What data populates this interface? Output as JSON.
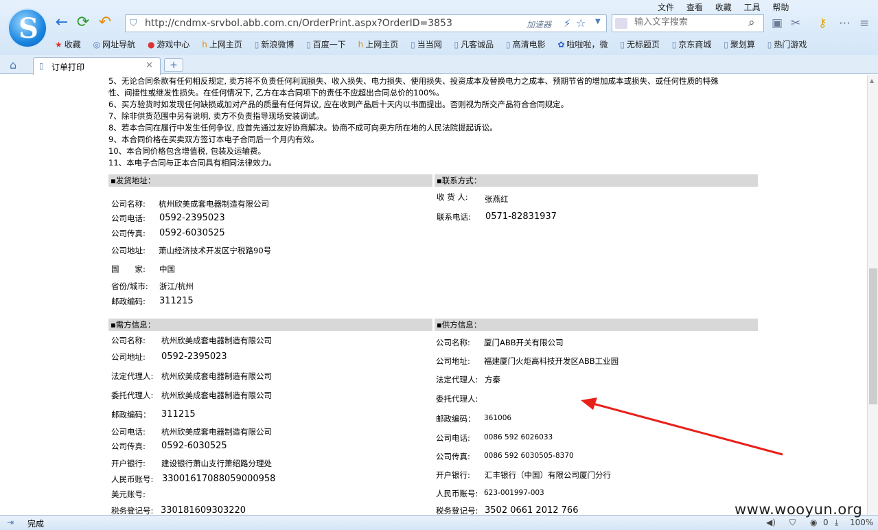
{
  "menu": [
    "文件",
    "查看",
    "收藏",
    "工具",
    "帮助"
  ],
  "address": {
    "url": "http://cndmx-srvbol.abb.com.cn/OrderPrint.aspx?OrderID=3853",
    "accelerator": "加速器"
  },
  "search": {
    "placeholder": "输入文字搜索"
  },
  "bookmarks": [
    "收藏",
    "网址导航",
    "游戏中心",
    "上网主页",
    "新浪微博",
    "百度一下",
    "上网主页",
    "当当网",
    "凡客诚品",
    "高清电影",
    "啦啦啦，微",
    "无标题页",
    "京东商城",
    "聚划算",
    "热门游戏"
  ],
  "tab": {
    "title": "订单打印"
  },
  "terms": [
    "5、无论合同条款有任何相反规定, 卖方将不负责任何利润损失、收入损失、电力损失、使用损失、投资成本及替换电力之成本、预期节省的增加成本或损失、或任何性质的特殊",
    "性、间接性或继发性损失。在任何情况下, 乙方在本合同项下的责任不应超出合同总价的100%。",
    "6、买方验货时如发现任何缺损或加对产品的质量有任何异议, 应在收到产品后十天内以书面提出。否则视为所交产品符合合同规定。",
    "7、除非供货范围中另有说明, 卖方不负责指导现场安装调试。",
    "8、若本合同在履行中发生任何争议, 应首先通过友好协商解决。协商不成可向卖方所在地的人民法院提起诉讼。",
    "9、本合同价格在买卖双方签订本电子合同后一个月内有效。",
    "10、本合同价格包含增值税, 包装及运输费。",
    "11、本电子合同与正本合同具有相同法律效力。"
  ],
  "shipping": {
    "header": "▪发货地址：",
    "company_k": "公司名称:",
    "company_v": "杭州欣美成套电器制造有限公司",
    "phone_k": "公司电话:",
    "phone_v": "0592-2395023",
    "fax_k": "公司传真:",
    "fax_v": "0592-6030525",
    "address_k": "公司地址:",
    "address_v": "萧山经济技术开发区宁税路90号",
    "country_k": "国　　家:",
    "country_v": "中国",
    "city_k": "省份/城市:",
    "city_v": "浙江/杭州",
    "zip_k": "邮政编码:",
    "zip_v": "311215"
  },
  "contact": {
    "header": "▪联系方式：",
    "recipient_k": "收 货 人:",
    "recipient_v": "张燕红",
    "phone_k": "联系电话:",
    "phone_v": "0571-82831937"
  },
  "buyer": {
    "header": "▪需方信息：",
    "company_k": "公司名称:",
    "company_v": "杭州欣美成套电器制造有限公司",
    "address_k": "公司地址:",
    "address_v": "0592-2395023",
    "legal_k": "法定代理人:",
    "legal_v": "杭州欣美成套电器制造有限公司",
    "agent_k": "委托代理人:",
    "agent_v": "杭州欣美成套电器制造有限公司",
    "zip_k": "邮政编码：",
    "zip_v": "311215",
    "phone_k": "公司电话:",
    "phone_v": "杭州欣美成套电器制造有限公司",
    "fax_k": "公司传真:",
    "fax_v": "0592-6030525",
    "bank_k": "开户银行:",
    "bank_v": "建设银行萧山支行萧绍路分理处",
    "rmb_k": "人民币账号:",
    "rmb_v": "33001617088059000958",
    "usd_k": "美元账号:",
    "usd_v": "",
    "tax_k": "税务登记号:",
    "tax_v": "330181609303220"
  },
  "supplier": {
    "header": "▪供方信息：",
    "company_k": "公司名称:",
    "company_v": "厦门ABB开关有限公司",
    "address_k": "公司地址:",
    "address_v": "福建厦门火炬高科技开发区ABB工业园",
    "legal_k": "法定代理人:",
    "legal_v": "方秦",
    "agent_k": "委托代理人:",
    "agent_v": "",
    "zip_k": "邮政编码：",
    "zip_v": "361006",
    "phone_k": "公司电话:",
    "phone_v": "0086 592 6026033",
    "fax_k": "公司传真:",
    "fax_v": "0086 592 6030505-8370",
    "bank_k": "开户银行:",
    "bank_v": "汇丰银行（中国）有限公司厦门分行",
    "rmb_k": "人民币账号:",
    "rmb_v": "623-001997-003",
    "tax_k": "税务登记号:",
    "tax_v": "3502 0661 2012 766"
  },
  "status": {
    "text": "完成",
    "count": "0",
    "zoom": "100%"
  },
  "watermark": "www.wooyun.org",
  "colors": {
    "annotation_arrow": "#e8201a",
    "section_bar": "#d8d8d8"
  }
}
